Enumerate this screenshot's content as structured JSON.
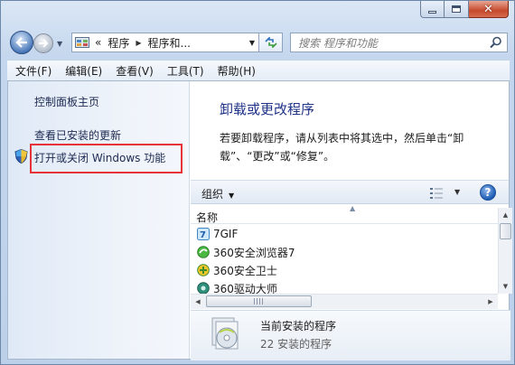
{
  "window": {
    "title_buttons": {
      "minimize": "minimize",
      "maximize": "maximize",
      "close": "✕"
    }
  },
  "navigation": {
    "breadcrumb_prefix": "«",
    "breadcrumb": [
      "程序",
      "程序和..."
    ],
    "search_placeholder": "搜索 程序和功能"
  },
  "menubar": {
    "items": [
      "文件(F)",
      "编辑(E)",
      "查看(V)",
      "工具(T)",
      "帮助(H)"
    ]
  },
  "left_pane": {
    "home_link": "控制面板主页",
    "updates_link": "查看已安装的更新",
    "features_link": "打开或关闭 Windows 功能"
  },
  "right_pane": {
    "title": "卸载或更改程序",
    "description": "若要卸载程序，请从列表中将其选中，然后单击“卸载”、“更改”或“修复”。"
  },
  "toolbar": {
    "organize_label": "组织",
    "help_label": "?"
  },
  "list": {
    "column_header": "名称",
    "items": [
      {
        "name": "7GIF",
        "icon": "7gif-icon"
      },
      {
        "name": "360安全浏览器7",
        "icon": "360-browser-icon"
      },
      {
        "name": "360安全卫士",
        "icon": "360-safeguard-icon"
      },
      {
        "name": "360驱动大师",
        "icon": "360-driver-icon"
      }
    ]
  },
  "details": {
    "title": "当前安装的程序",
    "count": "22 安装的程序"
  },
  "colors": {
    "link": "#1d2a52",
    "title": "#1e3287",
    "highlight": "#e8323a"
  }
}
